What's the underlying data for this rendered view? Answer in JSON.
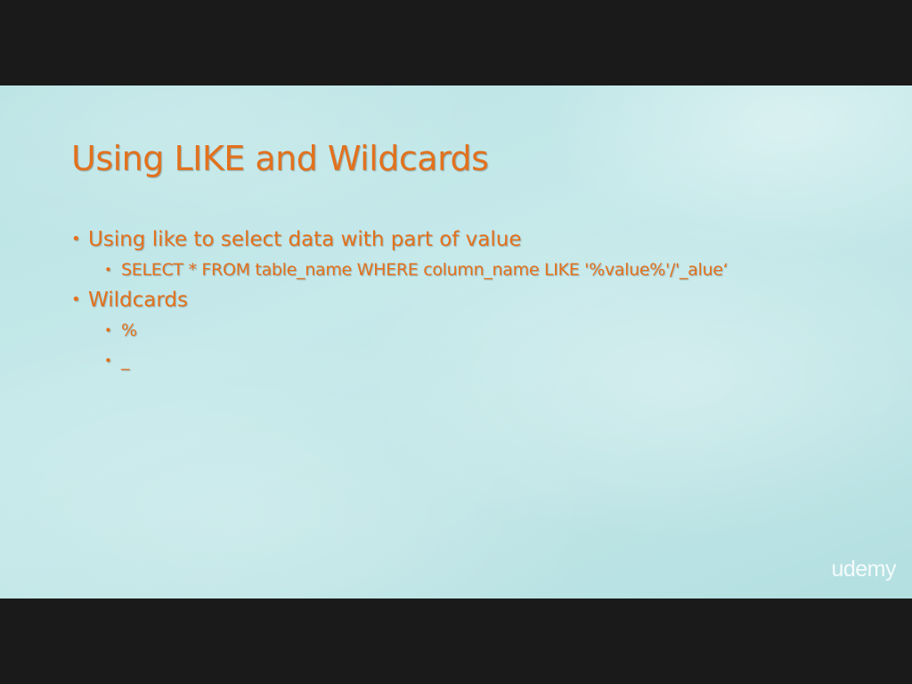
{
  "slide": {
    "title": "Using LIKE and Wildcards",
    "bullets": [
      {
        "text": "Using like to select data with part of value",
        "sub": [
          "SELECT * FROM table_name WHERE column_name LIKE '%value%'/'_alue‘"
        ]
      },
      {
        "text": "Wildcards",
        "sub": [
          "%",
          "_"
        ]
      }
    ],
    "bullet_glyph": "•"
  },
  "watermark": {
    "text": "udemy"
  },
  "colors": {
    "accent": "#e2711d",
    "background": "#c6e9ea",
    "letterbox": "#1a1a1a"
  }
}
